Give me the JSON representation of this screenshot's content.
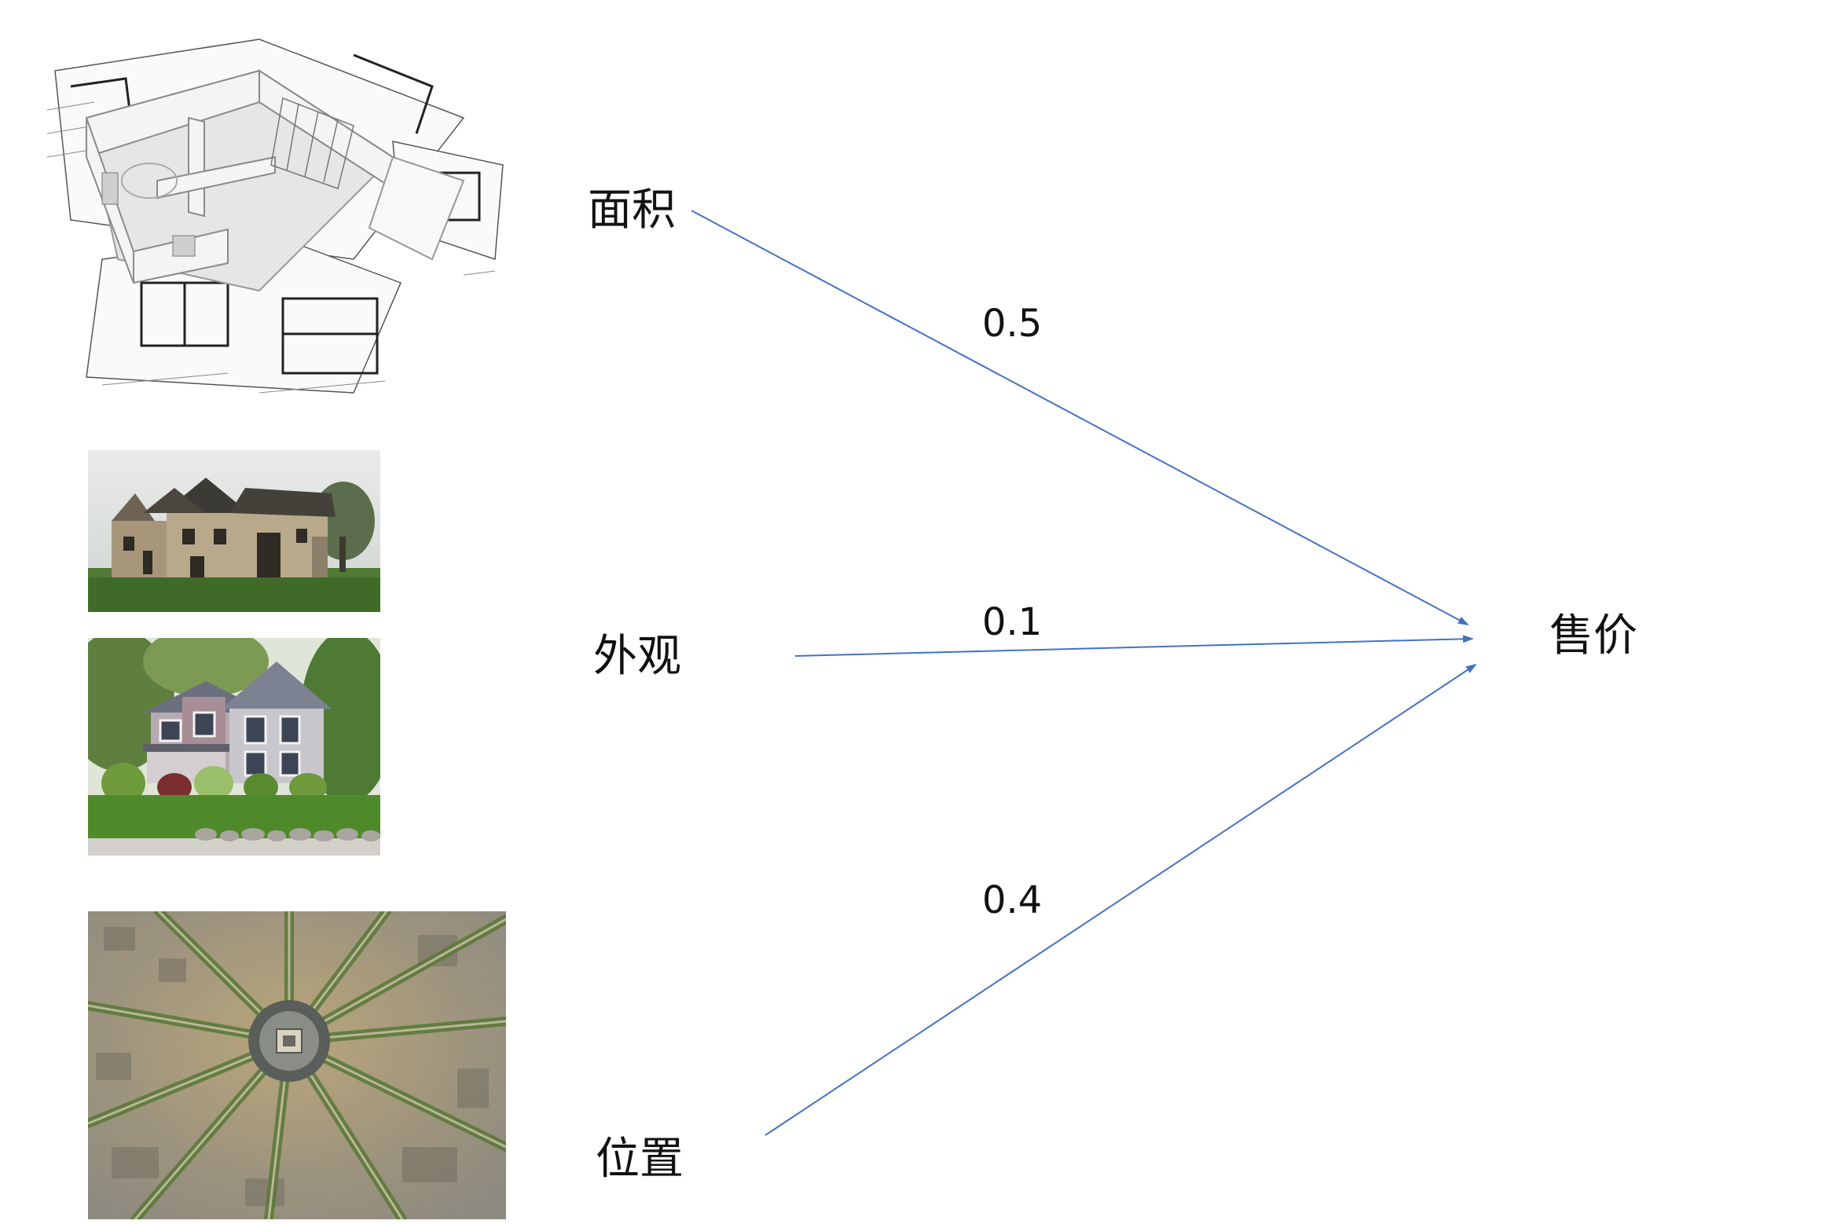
{
  "nodes": {
    "area": "面积",
    "appearance": "外观",
    "location": "位置",
    "price": "售价"
  },
  "weights": {
    "area_to_price": "0.5",
    "appearance_to_price": "0.1",
    "location_to_price": "0.4"
  },
  "colors": {
    "arrow": "#4472C4",
    "text": "#111111"
  },
  "images": [
    "house-blueprint-model-image",
    "old-farmhouse-photo",
    "suburban-house-photo",
    "city-aerial-radial-streets-photo"
  ]
}
